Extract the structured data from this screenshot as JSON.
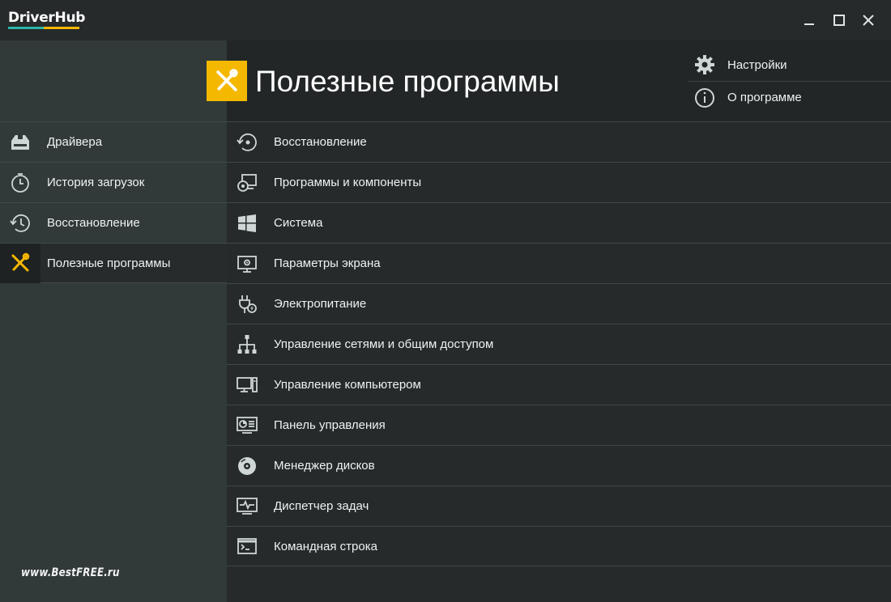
{
  "app": {
    "logo_text": "DriverHub",
    "colors": {
      "accent_yellow": "#f5b800",
      "accent_teal": "#2bb5a6"
    }
  },
  "window_controls": {
    "icons": [
      "minimize-icon",
      "maximize-icon",
      "close-icon"
    ]
  },
  "header": {
    "title": "Полезные программы",
    "icon": "tools-icon",
    "menu": [
      {
        "label": "Настройки",
        "icon": "gear-icon"
      },
      {
        "label": "О программе",
        "icon": "info-icon"
      }
    ]
  },
  "sidebar": {
    "items": [
      {
        "label": "Драйвера",
        "icon": "drive-icon",
        "active": false
      },
      {
        "label": "История загрузок",
        "icon": "timer-icon",
        "active": false
      },
      {
        "label": "Восстановление",
        "icon": "history-icon",
        "active": false
      },
      {
        "label": "Полезные программы",
        "icon": "tools-icon",
        "active": true
      }
    ],
    "watermark": "www.BestFREE.ru"
  },
  "tools": [
    {
      "label": "Восстановление",
      "icon": "restore-icon"
    },
    {
      "label": "Программы и компоненты",
      "icon": "programs-icon"
    },
    {
      "label": "Система",
      "icon": "windows-icon"
    },
    {
      "label": "Параметры экрана",
      "icon": "display-settings-icon"
    },
    {
      "label": "Электропитание",
      "icon": "power-plug-icon"
    },
    {
      "label": "Управление сетями и общим доступом",
      "icon": "network-icon"
    },
    {
      "label": "Управление компьютером",
      "icon": "computer-icon"
    },
    {
      "label": "Панель управления",
      "icon": "control-panel-icon"
    },
    {
      "label": "Менеджер дисков",
      "icon": "disk-icon"
    },
    {
      "label": "Диспетчер задач",
      "icon": "task-manager-icon"
    },
    {
      "label": "Командная строка",
      "icon": "terminal-icon"
    }
  ]
}
